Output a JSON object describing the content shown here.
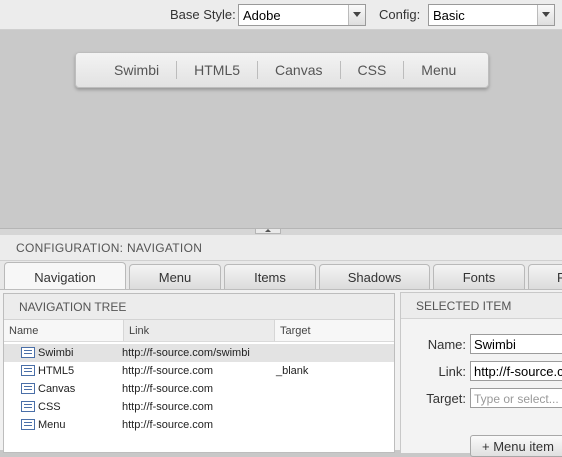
{
  "toolbar": {
    "base_style_label": "Base Style:",
    "base_style_value": "Adobe",
    "config_label": "Config:",
    "config_value": "Basic"
  },
  "preview": {
    "menu_items": [
      "Swimbi",
      "HTML5",
      "Canvas",
      "CSS",
      "Menu"
    ]
  },
  "config": {
    "header": "CONFIGURATION: NAVIGATION",
    "tabs": [
      "Navigation",
      "Menu",
      "Items",
      "Shadows",
      "Fonts",
      "P"
    ],
    "active_tab": "Navigation"
  },
  "tree": {
    "title": "NAVIGATION TREE",
    "columns": {
      "name": "Name",
      "link": "Link",
      "target": "Target"
    },
    "rows": [
      {
        "name": "Swimbi",
        "link": "http://f-source.com/swimbi",
        "target": ""
      },
      {
        "name": "HTML5",
        "link": "http://f-source.com",
        "target": "_blank"
      },
      {
        "name": "Canvas",
        "link": "http://f-source.com",
        "target": ""
      },
      {
        "name": "CSS",
        "link": "http://f-source.com",
        "target": ""
      },
      {
        "name": "Menu",
        "link": "http://f-source.com",
        "target": ""
      }
    ]
  },
  "selected_item": {
    "title": "SELECTED ITEM",
    "name_label": "Name:",
    "name_value": "Swimbi",
    "link_label": "Link:",
    "link_value": "http://f-source.com/swimbi",
    "target_label": "Target:",
    "target_placeholder": "Type or select...",
    "add_button": "+ Menu item"
  },
  "colors": {
    "preview_bg": "#c9c9c9",
    "icon_blue": "#4a6fa8",
    "selected_row": "#e3e3e3"
  }
}
